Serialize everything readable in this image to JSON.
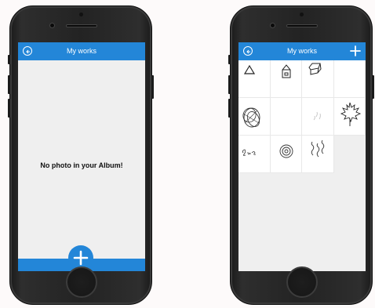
{
  "left_phone": {
    "header": {
      "title": "My works",
      "back_icon": "back-arrow-icon"
    },
    "empty_message": "No photo in your Album!",
    "fab_icon": "plus-icon"
  },
  "right_phone": {
    "header": {
      "title": "My works",
      "back_icon": "back-arrow-icon",
      "add_icon": "plus-icon"
    },
    "artworks": [
      {
        "name": "triangle-drawing"
      },
      {
        "name": "house-drawing"
      },
      {
        "name": "cube-drawing"
      },
      {
        "name": "blank-drawing"
      },
      {
        "name": "scribble-circle-drawing"
      },
      {
        "name": "blank-drawing"
      },
      {
        "name": "faint-marks-drawing"
      },
      {
        "name": "maple-leaf-drawing"
      },
      {
        "name": "handwriting-drawing"
      },
      {
        "name": "spiral-drawing"
      },
      {
        "name": "waves-drawing"
      }
    ]
  },
  "colors": {
    "accent": "#2386d8",
    "screen_bg": "#efefef",
    "phone_body": "#232323"
  }
}
